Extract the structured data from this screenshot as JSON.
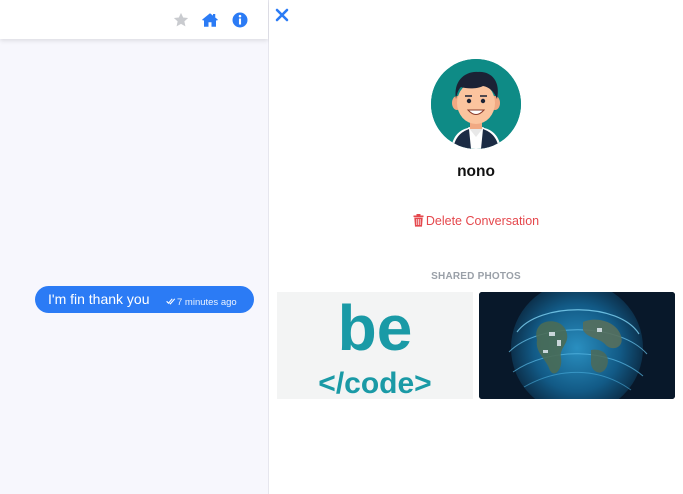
{
  "header_icons": [
    "star-icon",
    "home-icon",
    "info-icon"
  ],
  "colors": {
    "accent": "#2b7bf5",
    "danger": "#e5484d",
    "chat_bg": "#f7f7fd",
    "avatar_bg": "#0e8b86"
  },
  "message": {
    "text": "I'm fin thank you",
    "time": "7 minutes ago"
  },
  "profile": {
    "username": "nono"
  },
  "actions": {
    "delete_label": "Delete Conversation"
  },
  "shared": {
    "title": "SHARED PHOTOS",
    "photos": [
      {
        "logo_top": "be",
        "logo_bottom": "</code>"
      },
      {
        "name": "globe-image"
      }
    ]
  }
}
